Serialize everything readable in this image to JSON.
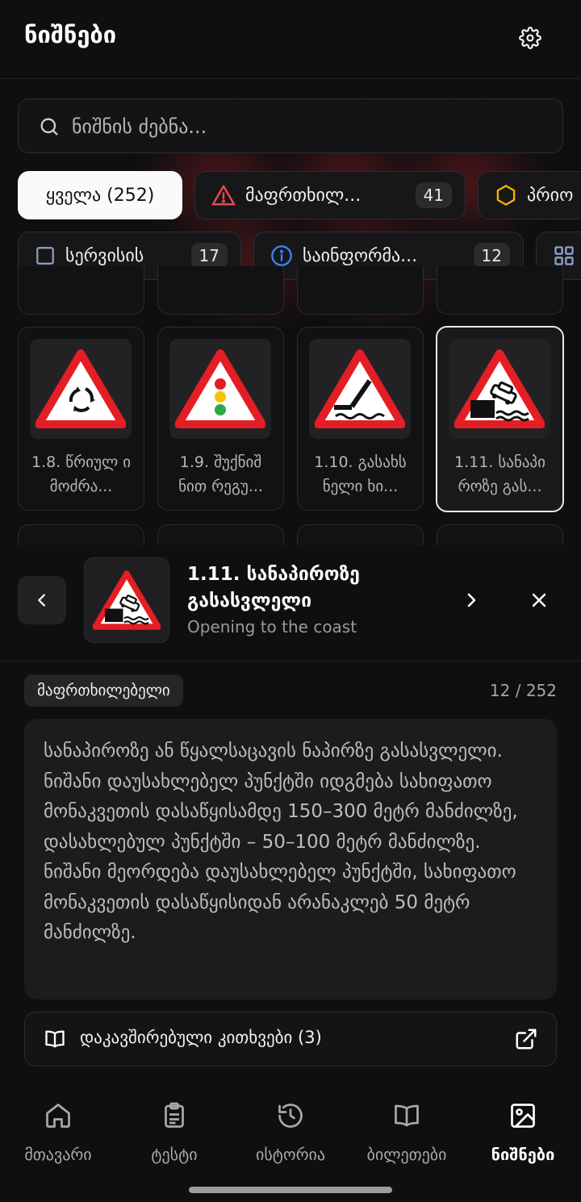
{
  "header": {
    "title": "ნიშნები",
    "settings_icon": "gear-icon"
  },
  "search": {
    "placeholder": "ნიშნის ძებნა..."
  },
  "filters": {
    "row1": [
      {
        "label": "ყველა (252)",
        "active": true
      },
      {
        "label": "მაფრთხილ...",
        "count": "41",
        "icon": "warning-triangle-icon",
        "icon_color": "#e5484d"
      },
      {
        "label": "პრიო",
        "icon": "hexagon-icon",
        "icon_color": "#f5b400"
      }
    ],
    "row2": [
      {
        "label": "სერვისის",
        "count": "17",
        "icon": "square-icon",
        "icon_color": "#8fa3c8"
      },
      {
        "label": "საინფორმა...",
        "count": "12",
        "icon": "info-icon",
        "icon_color": "#3b82f6"
      },
      {
        "label": "",
        "icon": "grid-icon",
        "icon_color": "#8fa3c8"
      }
    ]
  },
  "signs": [
    {
      "label": "1.8. წრიულ ი მოძრა...",
      "icon": "roundabout-sign-icon"
    },
    {
      "label": "1.9. შუქნიშ ნით რეგუ...",
      "icon": "traffic-light-sign-icon"
    },
    {
      "label": "1.10. გასახს ნელი ხი...",
      "icon": "drawbridge-sign-icon"
    },
    {
      "label": "1.11. სანაპი როზე გას...",
      "icon": "coast-exit-sign-icon",
      "selected": true
    }
  ],
  "detail": {
    "title": "1.11. სანაპიროზე გასასვლელი",
    "subtitle": "Opening to the coast",
    "category": "მაფრთხილებელი",
    "counter": "12 / 252",
    "description": "სანაპიროზე ან წყალსაცავის ნაპირზე გასასვლელი. ნიშანი დაუსახლებელ პუნქტში იდგმება სახიფათო მონაკვეთის დასაწყისამდე 150–300 მეტრ მანძილზე, დასახლებულ პუნქტში – 50–100 მეტრ მანძილზე. ნიშანი მეორდება დაუსახლებელ პუნქტში, სახიფათო მონაკვეთის დასაწყისიდან არანაკლებ 50 მეტრ მანძილზე.",
    "related_label": "დაკავშირებული კითხვები (3)"
  },
  "bottom_nav": [
    {
      "label": "მთავარი",
      "icon": "home-icon"
    },
    {
      "label": "ტესტი",
      "icon": "clipboard-icon"
    },
    {
      "label": "ისტორია",
      "icon": "history-icon"
    },
    {
      "label": "ბილეთები",
      "icon": "book-icon"
    },
    {
      "label": "ნიშნები",
      "icon": "image-icon",
      "active": true
    }
  ],
  "colors": {
    "background": "#0f0f10",
    "accent_red": "#e31e24",
    "warning": "#e5484d",
    "info": "#3b82f6"
  }
}
